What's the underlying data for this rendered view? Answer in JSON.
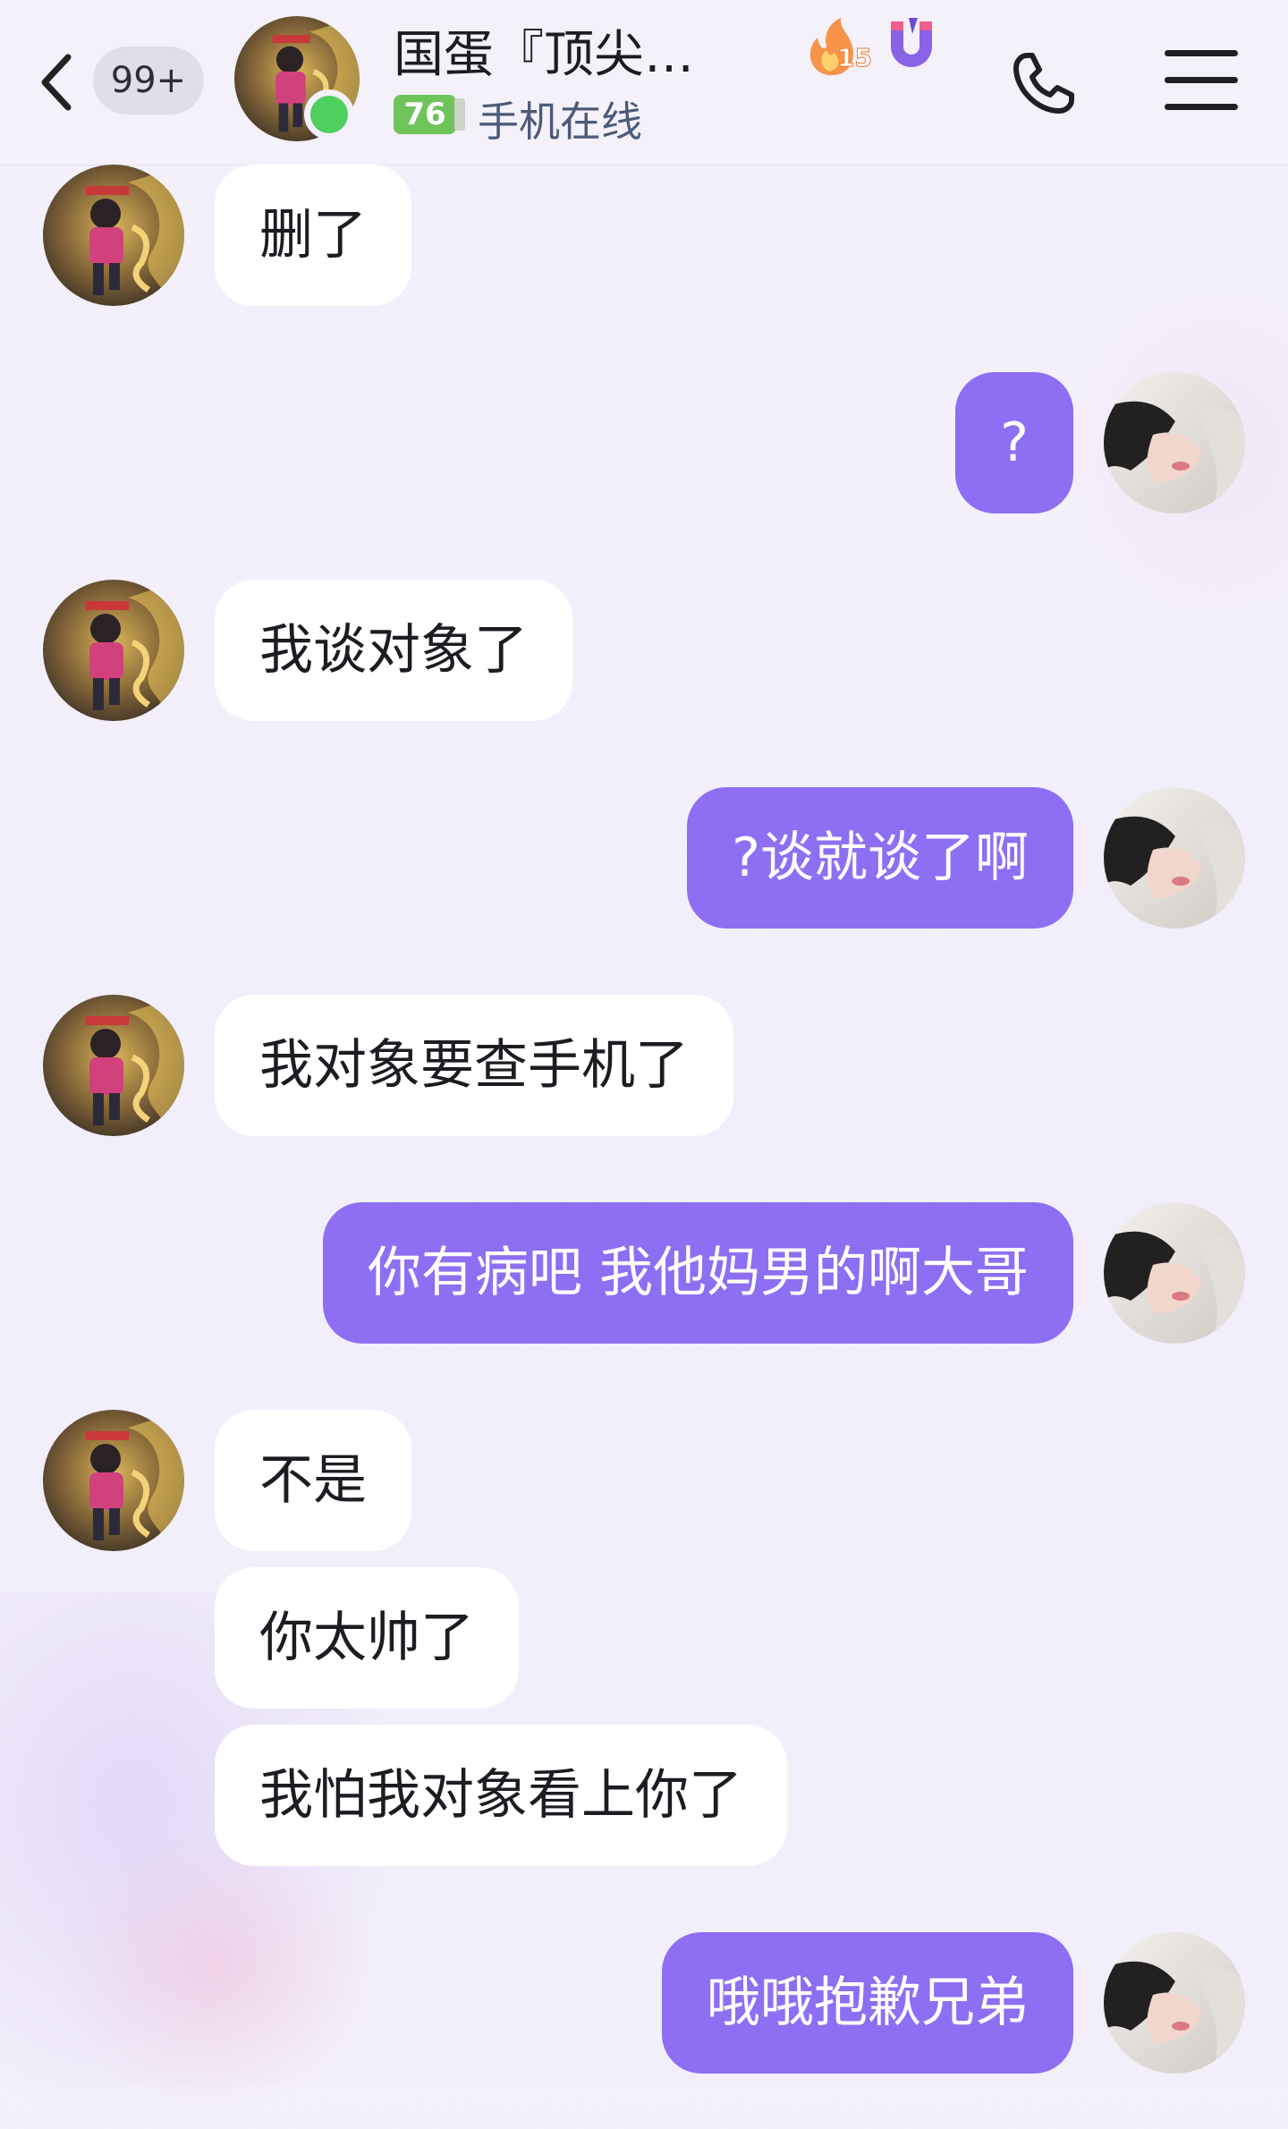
{
  "header": {
    "back_label": "back",
    "unread_badge": "99+",
    "title": "国蛋『顶尖…",
    "level": "76",
    "status": "手机在线",
    "fire_count": "15"
  },
  "messages": [
    {
      "side": "in",
      "text": "删了"
    },
    {
      "side": "out",
      "text": "?"
    },
    {
      "side": "in",
      "text": "我谈对象了"
    },
    {
      "side": "out",
      "text": "?谈就谈了啊"
    },
    {
      "side": "in",
      "text": "我对象要查手机了"
    },
    {
      "side": "out",
      "text": "你有病吧 我他妈男的啊大哥"
    },
    {
      "side": "in",
      "text": "不是"
    },
    {
      "side": "in",
      "text": "你太帅了"
    },
    {
      "side": "in",
      "text": "我怕我对象看上你了"
    },
    {
      "side": "out",
      "text": "哦哦抱歉兄弟"
    }
  ],
  "colors": {
    "outgoing_bubble": "#8e6ef3",
    "incoming_bubble": "#ffffff",
    "online": "#4fcf5e"
  }
}
